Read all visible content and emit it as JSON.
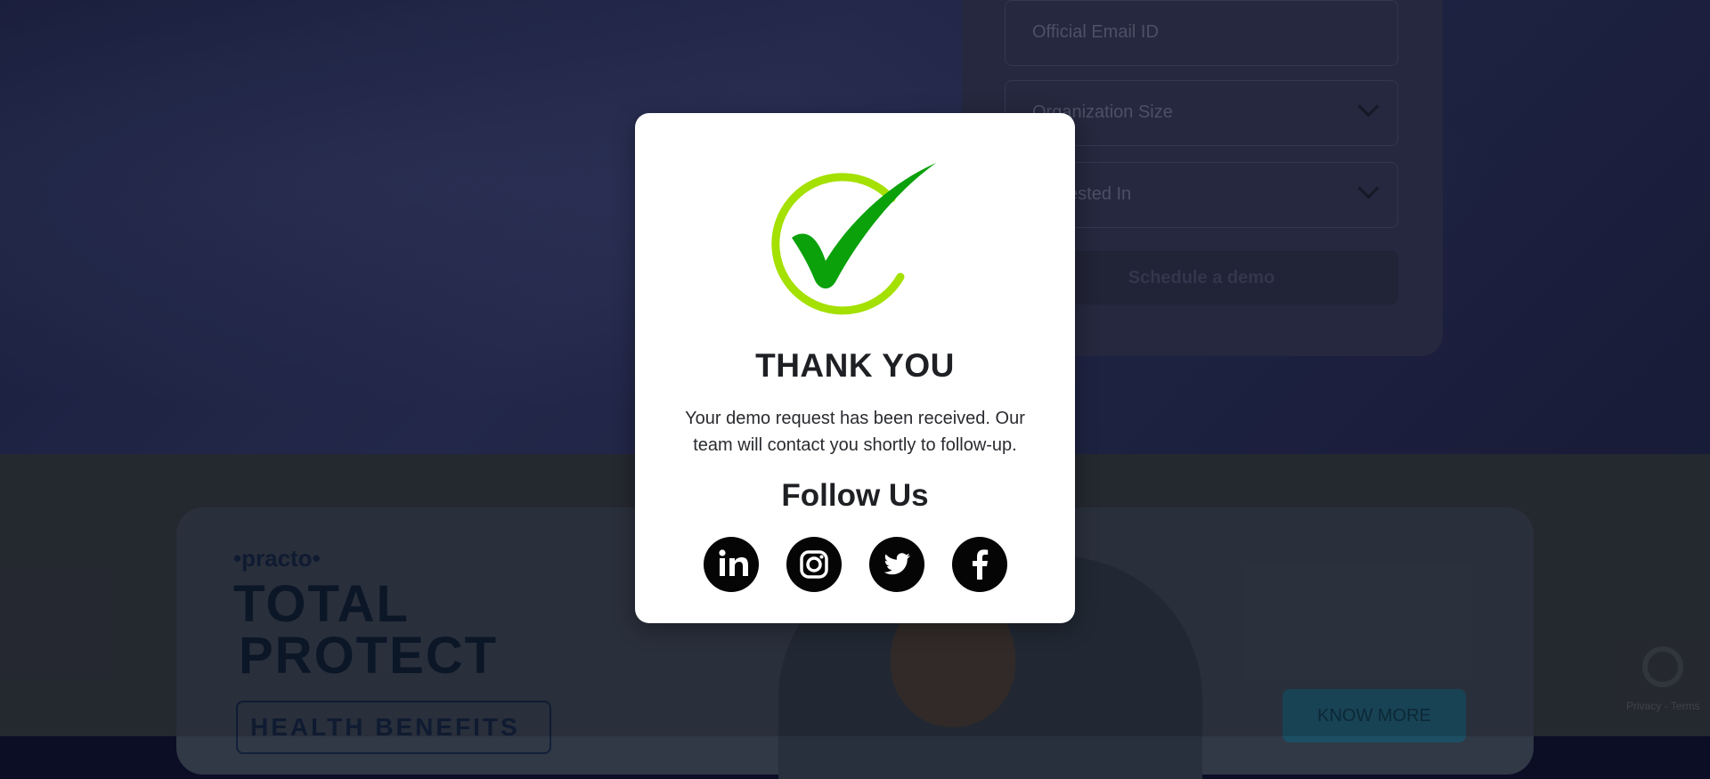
{
  "form": {
    "email_placeholder": "Official Email ID",
    "org_size_label": "Organization Size",
    "interested_label": "Interested In",
    "submit_label": "Schedule a demo"
  },
  "banner": {
    "brand": "•practo•",
    "title_line1": "TOTAL",
    "title_line2": "PROTECT",
    "health_label": "HEALTH BENEFITS",
    "cta_label": "KNOW MORE"
  },
  "recaptcha": {
    "links": "Privacy - Terms"
  },
  "modal": {
    "title": "THANK YOU",
    "message": "Your demo request has been received. Our team will contact you shortly to follow-up.",
    "follow_label": "Follow Us",
    "socials": [
      {
        "name": "LinkedIn",
        "icon": "linkedin-icon"
      },
      {
        "name": "Instagram",
        "icon": "instagram-icon"
      },
      {
        "name": "Twitter",
        "icon": "twitter-icon"
      },
      {
        "name": "Facebook",
        "icon": "facebook-icon"
      }
    ],
    "check_colors": {
      "ring": "#a4e000",
      "tick": "#0aa10a"
    }
  }
}
